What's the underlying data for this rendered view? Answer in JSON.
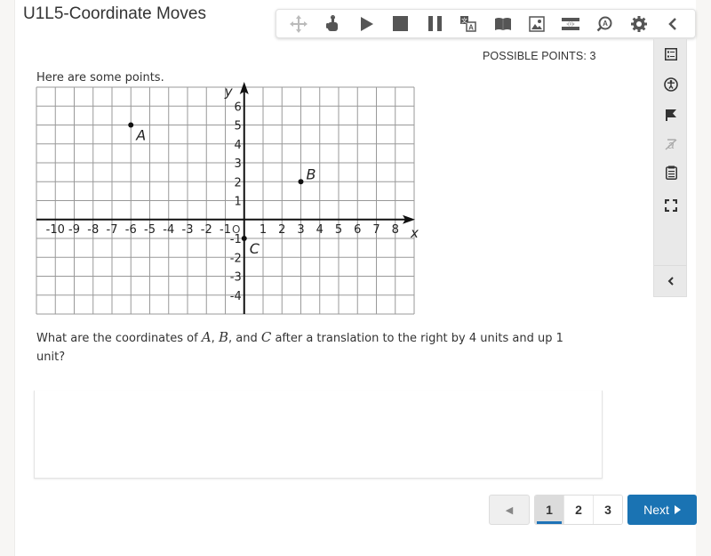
{
  "page": {
    "title": "U1L5-Coordinate Moves",
    "possible_points_label": "POSSIBLE POINTS: 3"
  },
  "toolbar": {
    "items": [
      {
        "icon": "move-icon",
        "label": "Move toolbar",
        "enabled": false
      },
      {
        "icon": "hand-pointer-icon",
        "label": "Point and read"
      },
      {
        "icon": "play-icon",
        "label": "Play"
      },
      {
        "icon": "stop-icon",
        "label": "Stop"
      },
      {
        "icon": "pause-icon",
        "label": "Pause"
      },
      {
        "icon": "translate-icon",
        "label": "Translate"
      },
      {
        "icon": "book-icon",
        "label": "Dictionary"
      },
      {
        "icon": "image-icon",
        "label": "Picture dictionary"
      },
      {
        "icon": "screen-mask-icon",
        "label": "Screen mask"
      },
      {
        "icon": "magnifier-icon",
        "label": "Magnifier"
      },
      {
        "icon": "gear-icon",
        "label": "Settings"
      },
      {
        "icon": "chevron-left-icon",
        "label": "Collapse toolbar"
      }
    ]
  },
  "side_panel": {
    "items": [
      {
        "icon": "question-list-icon",
        "label": "Question list"
      },
      {
        "icon": "accessibility-icon",
        "label": "Accessibility"
      },
      {
        "icon": "flag-icon",
        "label": "Flag question"
      },
      {
        "icon": "eliminate-answer-icon",
        "label": "Answer eliminator",
        "enabled": false
      },
      {
        "icon": "notepad-icon",
        "label": "Notepad"
      },
      {
        "icon": "fullscreen-icon",
        "label": "Full screen"
      }
    ],
    "collapse_icon": "chevron-left-icon"
  },
  "question": {
    "prompt": "Here are some points.",
    "text_before": "What are the coordinates of ",
    "var_a": "A",
    "sep1": ", ",
    "var_b": "B",
    "sep2": ", and ",
    "var_c": "C",
    "text_after": " after a translation to the right by 4 units and up 1 unit?",
    "answer_value": ""
  },
  "chart_data": {
    "type": "scatter",
    "title": "",
    "xlabel": "x",
    "ylabel": "y",
    "xlim": [
      -11,
      9
    ],
    "ylim": [
      -5,
      7
    ],
    "grid": true,
    "x_ticks": [
      -10,
      -9,
      -8,
      -7,
      -6,
      -5,
      -4,
      -3,
      -2,
      -1,
      1,
      2,
      3,
      4,
      5,
      6,
      7,
      8
    ],
    "y_ticks": [
      -4,
      -3,
      -2,
      -1,
      1,
      2,
      3,
      4,
      5,
      6
    ],
    "origin_label": "O",
    "points": [
      {
        "label": "A",
        "x": -6,
        "y": 5
      },
      {
        "label": "B",
        "x": 3,
        "y": 2
      },
      {
        "label": "C",
        "x": 0,
        "y": -1
      }
    ]
  },
  "pagination": {
    "prev_label": "◀",
    "pages": [
      "1",
      "2",
      "3"
    ],
    "current_page": "1",
    "next_label": "Next"
  }
}
